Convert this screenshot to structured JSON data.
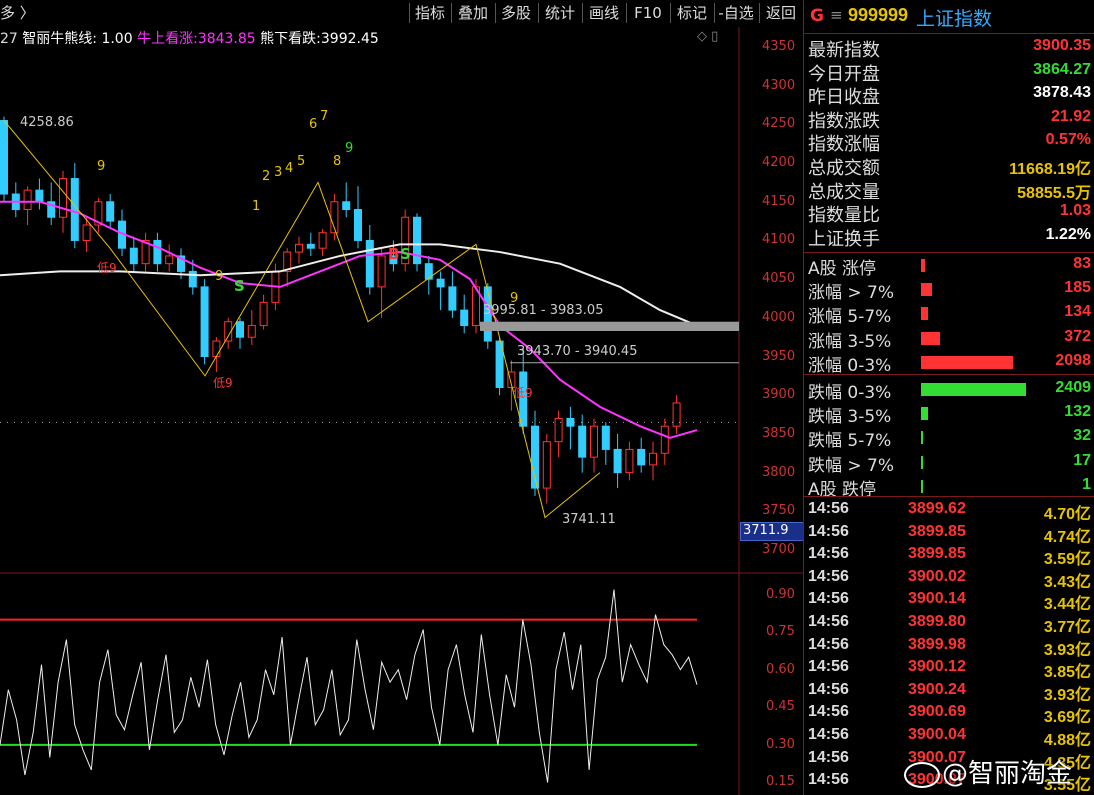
{
  "toolbar": {
    "left_label": "多 〉",
    "buttons": [
      "指标",
      "叠加",
      "多股",
      "统计",
      "画线",
      "F10",
      "标记",
      "-自选",
      "返回"
    ]
  },
  "legend": {
    "prefix": "27",
    "indicator_name": "智丽牛熊线: 1.00",
    "bull_label": "牛上看涨:",
    "bull_value": "3843.85",
    "bear_label": "熊下看跌:",
    "bear_value": "3992.45",
    "corner_icons": "◇ ▯"
  },
  "chart_data": {
    "type": "candlestick",
    "price_axis_ticks": [
      "4350",
      "4300",
      "4250",
      "4200",
      "4150",
      "4100",
      "4050",
      "4000",
      "3950",
      "3900",
      "3850",
      "3800",
      "3750",
      "3700"
    ],
    "price_range": [
      3700,
      4350
    ],
    "current_price_tag": "3711.9",
    "annotations": {
      "high": "4258.86",
      "low": "3741.11",
      "level_1": "3995.81 - 3983.05",
      "level_2": "3943.70 - 3940.45",
      "low9_a": "低9",
      "low9_b": "低9",
      "low9_c": "低9",
      "buy_s1": "S",
      "buy_s2": "S",
      "sell_b": "B",
      "seq": [
        "1",
        "2",
        "3",
        "4",
        "5",
        "6",
        "7",
        "8",
        "9"
      ],
      "nine_marks": [
        "9",
        "9",
        "9"
      ]
    },
    "indicator": {
      "axis_ticks": [
        "0.90",
        "0.75",
        "0.60",
        "0.45",
        "0.30",
        "0.15"
      ],
      "range": [
        0.15,
        0.95
      ],
      "upper_line": 0.8,
      "lower_line": 0.3,
      "values": [
        0.3,
        0.52,
        0.4,
        0.18,
        0.35,
        0.62,
        0.25,
        0.55,
        0.72,
        0.38,
        0.28,
        0.2,
        0.55,
        0.68,
        0.42,
        0.36,
        0.5,
        0.63,
        0.28,
        0.48,
        0.66,
        0.35,
        0.4,
        0.57,
        0.45,
        0.64,
        0.38,
        0.26,
        0.42,
        0.55,
        0.33,
        0.4,
        0.6,
        0.5,
        0.73,
        0.3,
        0.48,
        0.65,
        0.38,
        0.44,
        0.6,
        0.34,
        0.4,
        0.72,
        0.52,
        0.36,
        0.63,
        0.55,
        0.6,
        0.48,
        0.66,
        0.76,
        0.45,
        0.3,
        0.6,
        0.7,
        0.5,
        0.35,
        0.74,
        0.5,
        0.3,
        0.58,
        0.45,
        0.8,
        0.62,
        0.35,
        0.15,
        0.6,
        0.75,
        0.52,
        0.7,
        0.2,
        0.56,
        0.65,
        0.92,
        0.55,
        0.7,
        0.62,
        0.55,
        0.82,
        0.7,
        0.66,
        0.6,
        0.65,
        0.54
      ]
    }
  },
  "panel": {
    "header_g": "G",
    "header_icon": "≡",
    "code": "999999",
    "name": "上证指数",
    "stats": [
      {
        "label": "最新指数",
        "value": "3900.35",
        "color": "#ff3333"
      },
      {
        "label": "今日开盘",
        "value": "3864.27",
        "color": "#33dd33"
      },
      {
        "label": "昨日收盘",
        "value": "3878.43",
        "color": "#ffffff"
      },
      {
        "label": "指数涨跌",
        "value": "21.92",
        "color": "#ff3333"
      },
      {
        "label": "指数涨幅",
        "value": "0.57%",
        "color": "#ff3333"
      },
      {
        "label": "总成交额",
        "value": "11668.19亿",
        "color": "#e8c400"
      },
      {
        "label": "总成交量",
        "value": "58855.5万",
        "color": "#e8c400"
      },
      {
        "label": "指数量比",
        "value": "1.03",
        "color": "#ff3333"
      },
      {
        "label": "上证换手",
        "value": "1.22%",
        "color": "#ffffff"
      }
    ],
    "breadth": [
      {
        "label": "A股 涨停",
        "value": "83",
        "color": "#ff3333",
        "bar": 0.02
      },
      {
        "label": "涨幅 > 7%",
        "value": "185",
        "color": "#ff3333",
        "bar": 0.05
      },
      {
        "label": "涨幅 5-7%",
        "value": "134",
        "color": "#ff3333",
        "bar": 0.035
      },
      {
        "label": "涨幅 3-5%",
        "value": "372",
        "color": "#ff3333",
        "bar": 0.09
      },
      {
        "label": "涨幅 0-3%",
        "value": "2098",
        "color": "#ff3333",
        "bar": 0.44
      },
      {
        "label": "跌幅 0-3%",
        "value": "2409",
        "color": "#33dd33",
        "bar": 0.5
      },
      {
        "label": "跌幅 3-5%",
        "value": "132",
        "color": "#33dd33",
        "bar": 0.035
      },
      {
        "label": "跌幅 5-7%",
        "value": "32",
        "color": "#33dd33",
        "bar": 0.008
      },
      {
        "label": "跌幅 > 7%",
        "value": "17",
        "color": "#33dd33",
        "bar": 0.005
      },
      {
        "label": "A股 跌停",
        "value": "1",
        "color": "#33dd33",
        "bar": 0.002
      }
    ],
    "ticks": [
      {
        "time": "14:56",
        "price": "3899.62",
        "amount": "4.70亿"
      },
      {
        "time": "14:56",
        "price": "3899.85",
        "amount": "4.74亿"
      },
      {
        "time": "14:56",
        "price": "3899.85",
        "amount": "3.59亿"
      },
      {
        "time": "14:56",
        "price": "3900.02",
        "amount": "3.43亿"
      },
      {
        "time": "14:56",
        "price": "3900.14",
        "amount": "3.44亿"
      },
      {
        "time": "14:56",
        "price": "3899.80",
        "amount": "3.77亿"
      },
      {
        "time": "14:56",
        "price": "3899.98",
        "amount": "3.93亿"
      },
      {
        "time": "14:56",
        "price": "3900.12",
        "amount": "3.85亿"
      },
      {
        "time": "14:56",
        "price": "3900.24",
        "amount": "3.93亿"
      },
      {
        "time": "14:56",
        "price": "3900.69",
        "amount": "3.69亿"
      },
      {
        "time": "14:56",
        "price": "3900.04",
        "amount": "4.88亿"
      },
      {
        "time": "14:56",
        "price": "3900.07",
        "amount": "4.35亿"
      },
      {
        "time": "14:56",
        "price": "3900.07",
        "amount": "3.55亿"
      }
    ]
  },
  "watermark": "@智丽淘金"
}
